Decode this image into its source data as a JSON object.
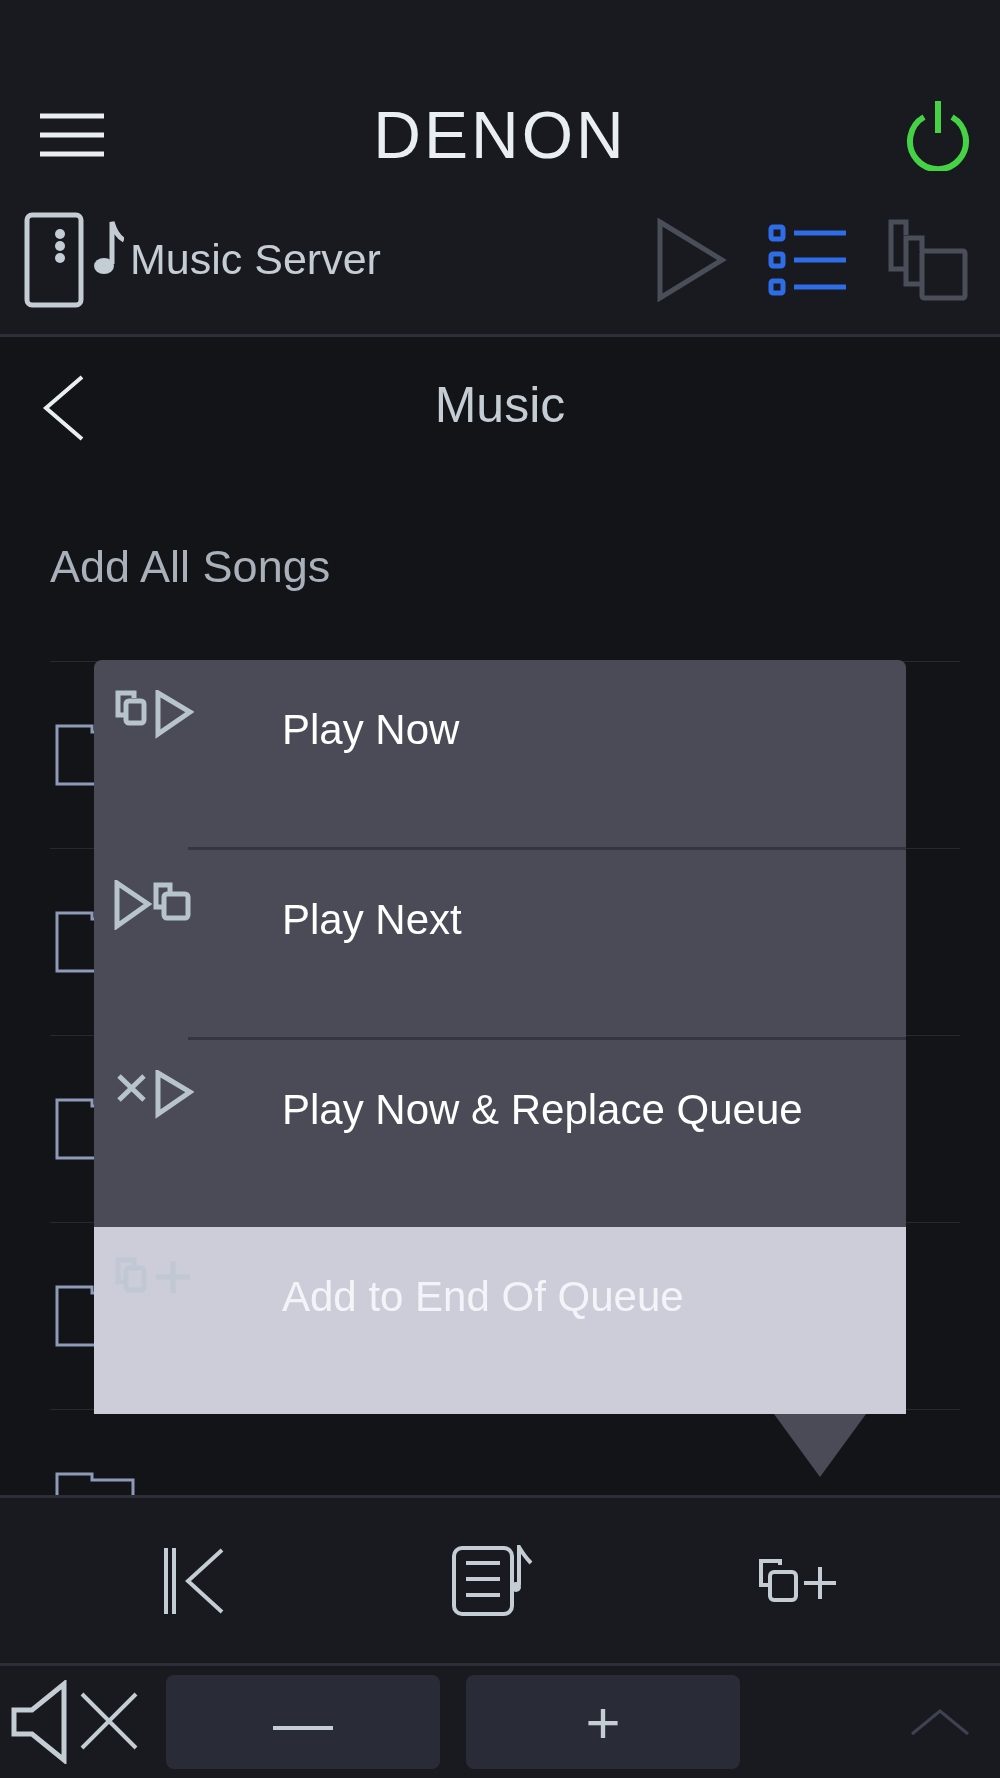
{
  "header": {
    "logo": "DENON",
    "power": {
      "on": true
    }
  },
  "source": {
    "label": "Music Server"
  },
  "view_tabs": [
    {
      "kind": "play",
      "selected": false
    },
    {
      "kind": "list",
      "selected": true
    },
    {
      "kind": "queue",
      "selected": false
    }
  ],
  "page_title": "Music",
  "add_all": "Add All Songs",
  "folder_rows": [
    {
      "kind": "folder"
    },
    {
      "kind": "folder"
    },
    {
      "kind": "folder"
    },
    {
      "kind": "folder"
    },
    {
      "kind": "folder"
    }
  ],
  "popup_menu": [
    {
      "kind": "play_now",
      "label": "Play Now",
      "selected": false
    },
    {
      "kind": "play_next",
      "label": "Play Next",
      "selected": false
    },
    {
      "kind": "replace",
      "label": "Play Now & Replace Queue",
      "selected": false
    },
    {
      "kind": "add_end",
      "label": "Add to End Of Queue",
      "selected": true
    }
  ],
  "controls": [
    {
      "kind": "previous"
    },
    {
      "kind": "now_playing"
    },
    {
      "kind": "add_queue"
    }
  ],
  "volume": {
    "muted": true,
    "minus": "—",
    "plus": "+"
  }
}
